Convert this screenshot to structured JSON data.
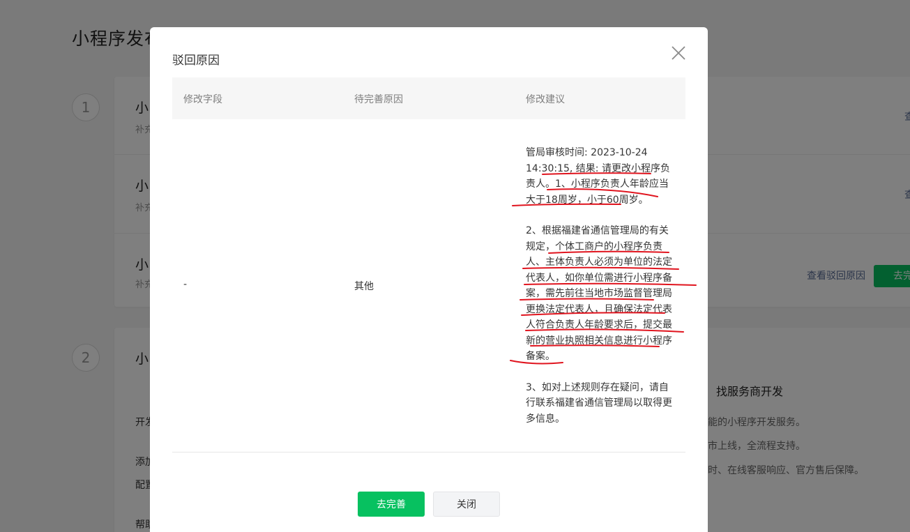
{
  "background": {
    "page_title": "小程序发布",
    "step1": "1",
    "step2": "2",
    "rows": [
      {
        "title": "小",
        "sub": "补充",
        "link": "查"
      },
      {
        "title": "小",
        "sub": "补充",
        "link": "查"
      },
      {
        "title": "小",
        "sub": "补充",
        "link": "查看驳回原因",
        "button": "去完善"
      }
    ],
    "section2_title": "小",
    "labels": [
      "开发",
      "添加",
      "配置",
      "帮助"
    ],
    "service": {
      "title": "找服务商开发",
      "lines": [
        "能的小程序开发服务。",
        "市上线，全流程支持。",
        "时、在线客服响应、官方售后保障。"
      ]
    }
  },
  "dialog": {
    "title": "驳回原因",
    "columns": [
      "修改字段",
      "待完善原因",
      "修改建议"
    ],
    "row": {
      "field": "-",
      "reason": "其他",
      "advice": [
        "管局审核时间: 2023-10-24 14:30:15, 结果: 请更改小程序负责人。1、小程序负责人年龄应当大于18周岁，小于60周岁。",
        "2、根据福建省通信管理局的有关规定，个体工商户的小程序负责人、主体负责人必须为单位的法定代表人，如你单位需进行小程序备案，需先前往当地市场监督管理局更换法定代表人，且确保法定代表人符合负责人年龄要求后，提交最新的营业执照相关信息进行小程序备案。",
        "3、如对上述规则存在疑问，请自行联系福建省通信管理局以取得更多信息。"
      ]
    },
    "buttons": {
      "primary": "去完善",
      "close": "关闭"
    },
    "annotation_color": "#e0141e"
  }
}
